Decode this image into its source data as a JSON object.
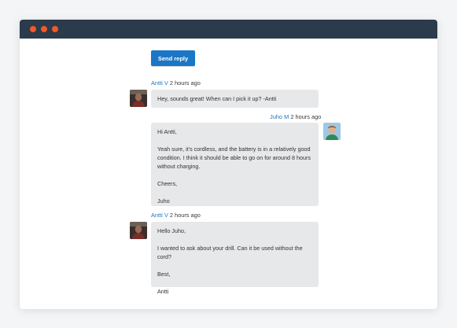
{
  "compose": {
    "send_label": "Send reply"
  },
  "messages": [
    {
      "author": "Antti V",
      "time": "2 hours ago",
      "lines": [
        "Hey, sounds great! When can I pick it up? -Antti"
      ]
    },
    {
      "author": "Juho M",
      "time": "2 hours ago",
      "lines": [
        "Hi Antti,",
        "",
        "Yeah sure, it's cordless, and the battery is in a relatively good",
        "condition. I think it should be able to go on for around 8 hours",
        "without charging.",
        "",
        "Cheers,",
        "",
        "Juho"
      ]
    },
    {
      "author": "Antti V",
      "time": "2 hours ago",
      "lines": [
        "Hello Juho,",
        "",
        "I wanted to ask about your drill. Can it be used without the cord?",
        "",
        "Best,",
        "",
        "Antti"
      ]
    }
  ],
  "colors": {
    "titlebar": "#2b3b4c",
    "window_dot": "#f05a28",
    "primary": "#1b76c5",
    "bubble": "#e7e8e9"
  }
}
